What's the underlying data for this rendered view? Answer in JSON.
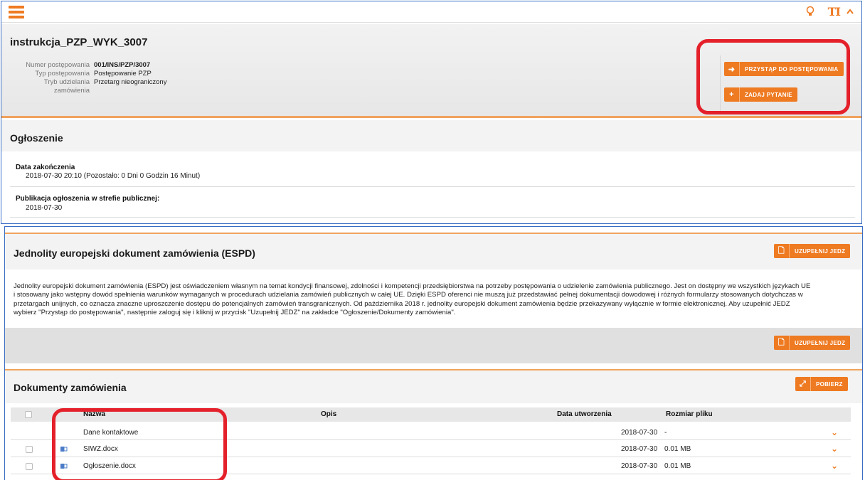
{
  "topbar": {
    "menu_icon": "hamburger-icon",
    "bulb_icon": "lightbulb-icon",
    "text_size_label": "TI",
    "collapse_icon": "chevron-up-icon"
  },
  "header": {
    "title": "instrukcja_PZP_WYK_3007",
    "fields": [
      {
        "key": "Numer postępowania",
        "value": "001/INS/PZP/3007",
        "bold": true
      },
      {
        "key": "Typ postępowania",
        "value": "Postępowanie PZP",
        "bold": false
      },
      {
        "key": "Tryb udzielania",
        "value": "Przetarg nieograniczony",
        "bold": false
      },
      {
        "key": "zamówienia",
        "value": "",
        "bold": false
      }
    ],
    "join_button": "PRZYSTĄP DO POSTĘPOWANIA",
    "ask_button": "ZADAJ PYTANIE"
  },
  "ogloszenie": {
    "title": "Ogłoszenie",
    "end_date_label": "Data zakończenia",
    "end_date_value": "2018-07-30 20:10 (Pozostało: 0 Dni 0 Godzin 16 Minut)",
    "publication_label": "Publikacja ogłoszenia w strefie publicznej:",
    "publication_value": "2018-07-30"
  },
  "espd": {
    "title": "Jednolity europejski dokument zamówienia (ESPD)",
    "button_label": "UZUPEŁNIJ JEDZ",
    "paragraph_lines": [
      "Jednolity europejski dokument zamówienia (ESPD) jest oświadczeniem własnym na temat kondycji finansowej, zdolności i kompetencji przedsiębiorstwa na potrzeby postępowania o udzielenie zamówienia publicznego. Jest on dostępny we wszystkich językach UE",
      "i stosowany jako wstępny dowód spełnienia warunków wymaganych w procedurach udzielania zamówień publicznych w całej UE. Dzięki ESPD oferenci nie muszą już przedstawiać pełnej dokumentacji dowodowej i różnych formularzy stosowanych dotychczas w",
      "przetargach unijnych, co oznacza znaczne uproszczenie dostępu do potencjalnych zamówień transgranicznych. Od października 2018 r. jednolity europejski dokument zamówienia będzie przekazywany wyłącznie w formie elektronicznej. Aby uzupełnić JEDZ",
      "wybierz \"Przystąp do postępowania\", następnie zaloguj się i kliknij w przycisk \"Uzupełnij JEDZ\" na zakładce \"Ogłoszenie/Dokumenty zamówienia\"."
    ],
    "bottom_button_label": "UZUPEŁNIJ JEDZ"
  },
  "documents": {
    "title": "Dokumenty zamówienia",
    "download_button": "POBIERZ",
    "columns": [
      "Nazwa",
      "Opis",
      "Data utworzenia",
      "Rozmiar pliku"
    ],
    "rows": [
      {
        "name": "Dane kontaktowe",
        "description": "",
        "date": "2018-07-30",
        "size": "-",
        "has_checkbox": false,
        "has_icon": false
      },
      {
        "name": "SIWZ.docx",
        "description": "",
        "date": "2018-07-30",
        "size": "0.01 MB",
        "has_checkbox": true,
        "has_icon": true
      },
      {
        "name": "Ogłoszenie.docx",
        "description": "",
        "date": "2018-07-30",
        "size": "0.01 MB",
        "has_checkbox": true,
        "has_icon": true
      }
    ]
  },
  "colors": {
    "accent": "#ee7a22",
    "highlight": "#e4202a",
    "frame": "#3a6ec4"
  }
}
